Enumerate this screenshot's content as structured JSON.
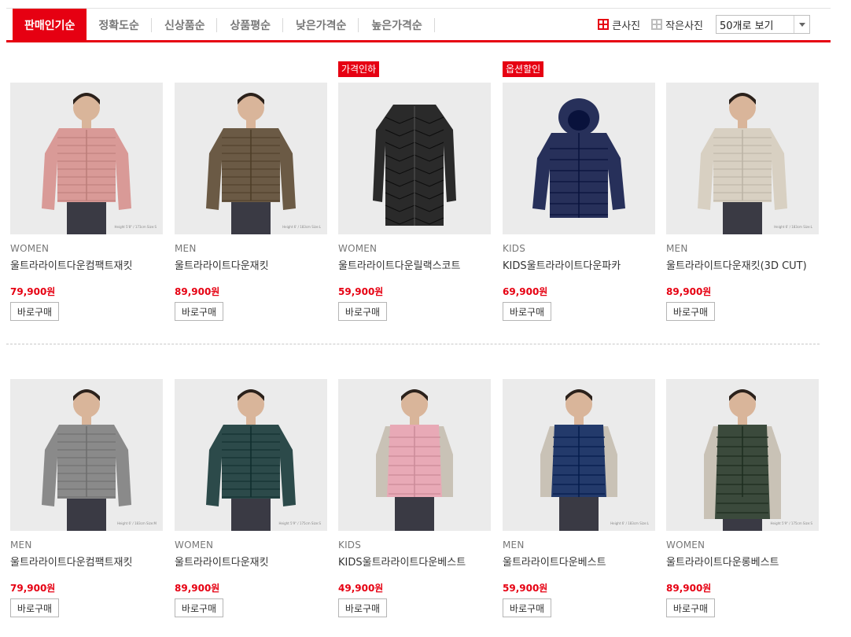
{
  "sort": {
    "tabs": [
      {
        "label": "판매인기순",
        "active": true
      },
      {
        "label": "정확도순",
        "active": false
      },
      {
        "label": "신상품순",
        "active": false
      },
      {
        "label": "상품평순",
        "active": false
      },
      {
        "label": "낮은가격순",
        "active": false
      },
      {
        "label": "높은가격순",
        "active": false
      }
    ],
    "view_large": "큰사진",
    "view_small": "작은사진",
    "page_size": "50개로 보기"
  },
  "colors": {
    "accent": "#e60012",
    "photo_bg": "#ebebeb"
  },
  "buy_label": "바로구매",
  "products": [
    {
      "badge": "",
      "category": "WOMEN",
      "name": "울트라라이트다운컴팩트재킷",
      "price": "79,900원",
      "height_note": "Height 5'8\" / 173cm Size:S",
      "garment_color": "#d99a97",
      "garment": "jacket"
    },
    {
      "badge": "",
      "category": "MEN",
      "name": "울트라라이트다운재킷",
      "price": "89,900원",
      "height_note": "Height 6' / 183cm Size:L",
      "garment_color": "#6b5a45",
      "garment": "jacket"
    },
    {
      "badge": "가격인하",
      "category": "WOMEN",
      "name": "울트라라이트다운릴랙스코트",
      "price": "59,900원",
      "height_note": "",
      "garment_color": "#2a2a2a",
      "garment": "coat"
    },
    {
      "badge": "옵션할인",
      "category": "KIDS",
      "name": "KIDS울트라라이트다운파카",
      "price": "69,900원",
      "height_note": "",
      "garment_color": "#27305a",
      "garment": "parka"
    },
    {
      "badge": "",
      "category": "MEN",
      "name": "울트라라이트다운재킷(3D CUT)",
      "price": "89,900원",
      "height_note": "Height 6' / 183cm Size:L",
      "garment_color": "#d8d0c2",
      "garment": "jacket"
    },
    {
      "badge": "",
      "category": "MEN",
      "name": "울트라라이트다운컴팩트재킷",
      "price": "79,900원",
      "height_note": "Height 6' / 183cm Size:M",
      "garment_color": "#8a8a8a",
      "garment": "jacket"
    },
    {
      "badge": "",
      "category": "WOMEN",
      "name": "울트라라이트다운재킷",
      "price": "89,900원",
      "height_note": "Height 5'9\" / 175cm Size:S",
      "garment_color": "#2c4a4a",
      "garment": "jacket"
    },
    {
      "badge": "",
      "category": "KIDS",
      "name": "KIDS울트라라이트다운베스트",
      "price": "49,900원",
      "height_note": "",
      "garment_color": "#e8a9b6",
      "garment": "vest"
    },
    {
      "badge": "",
      "category": "MEN",
      "name": "울트라라이트다운베스트",
      "price": "59,900원",
      "height_note": "Height 6' / 183cm Size:L",
      "garment_color": "#233a6b",
      "garment": "vest"
    },
    {
      "badge": "",
      "category": "WOMEN",
      "name": "울트라라이트다운롱베스트",
      "price": "89,900원",
      "height_note": "Height 5'9\" / 175cm Size:S",
      "garment_color": "#3b4a3c",
      "garment": "longvest"
    }
  ]
}
